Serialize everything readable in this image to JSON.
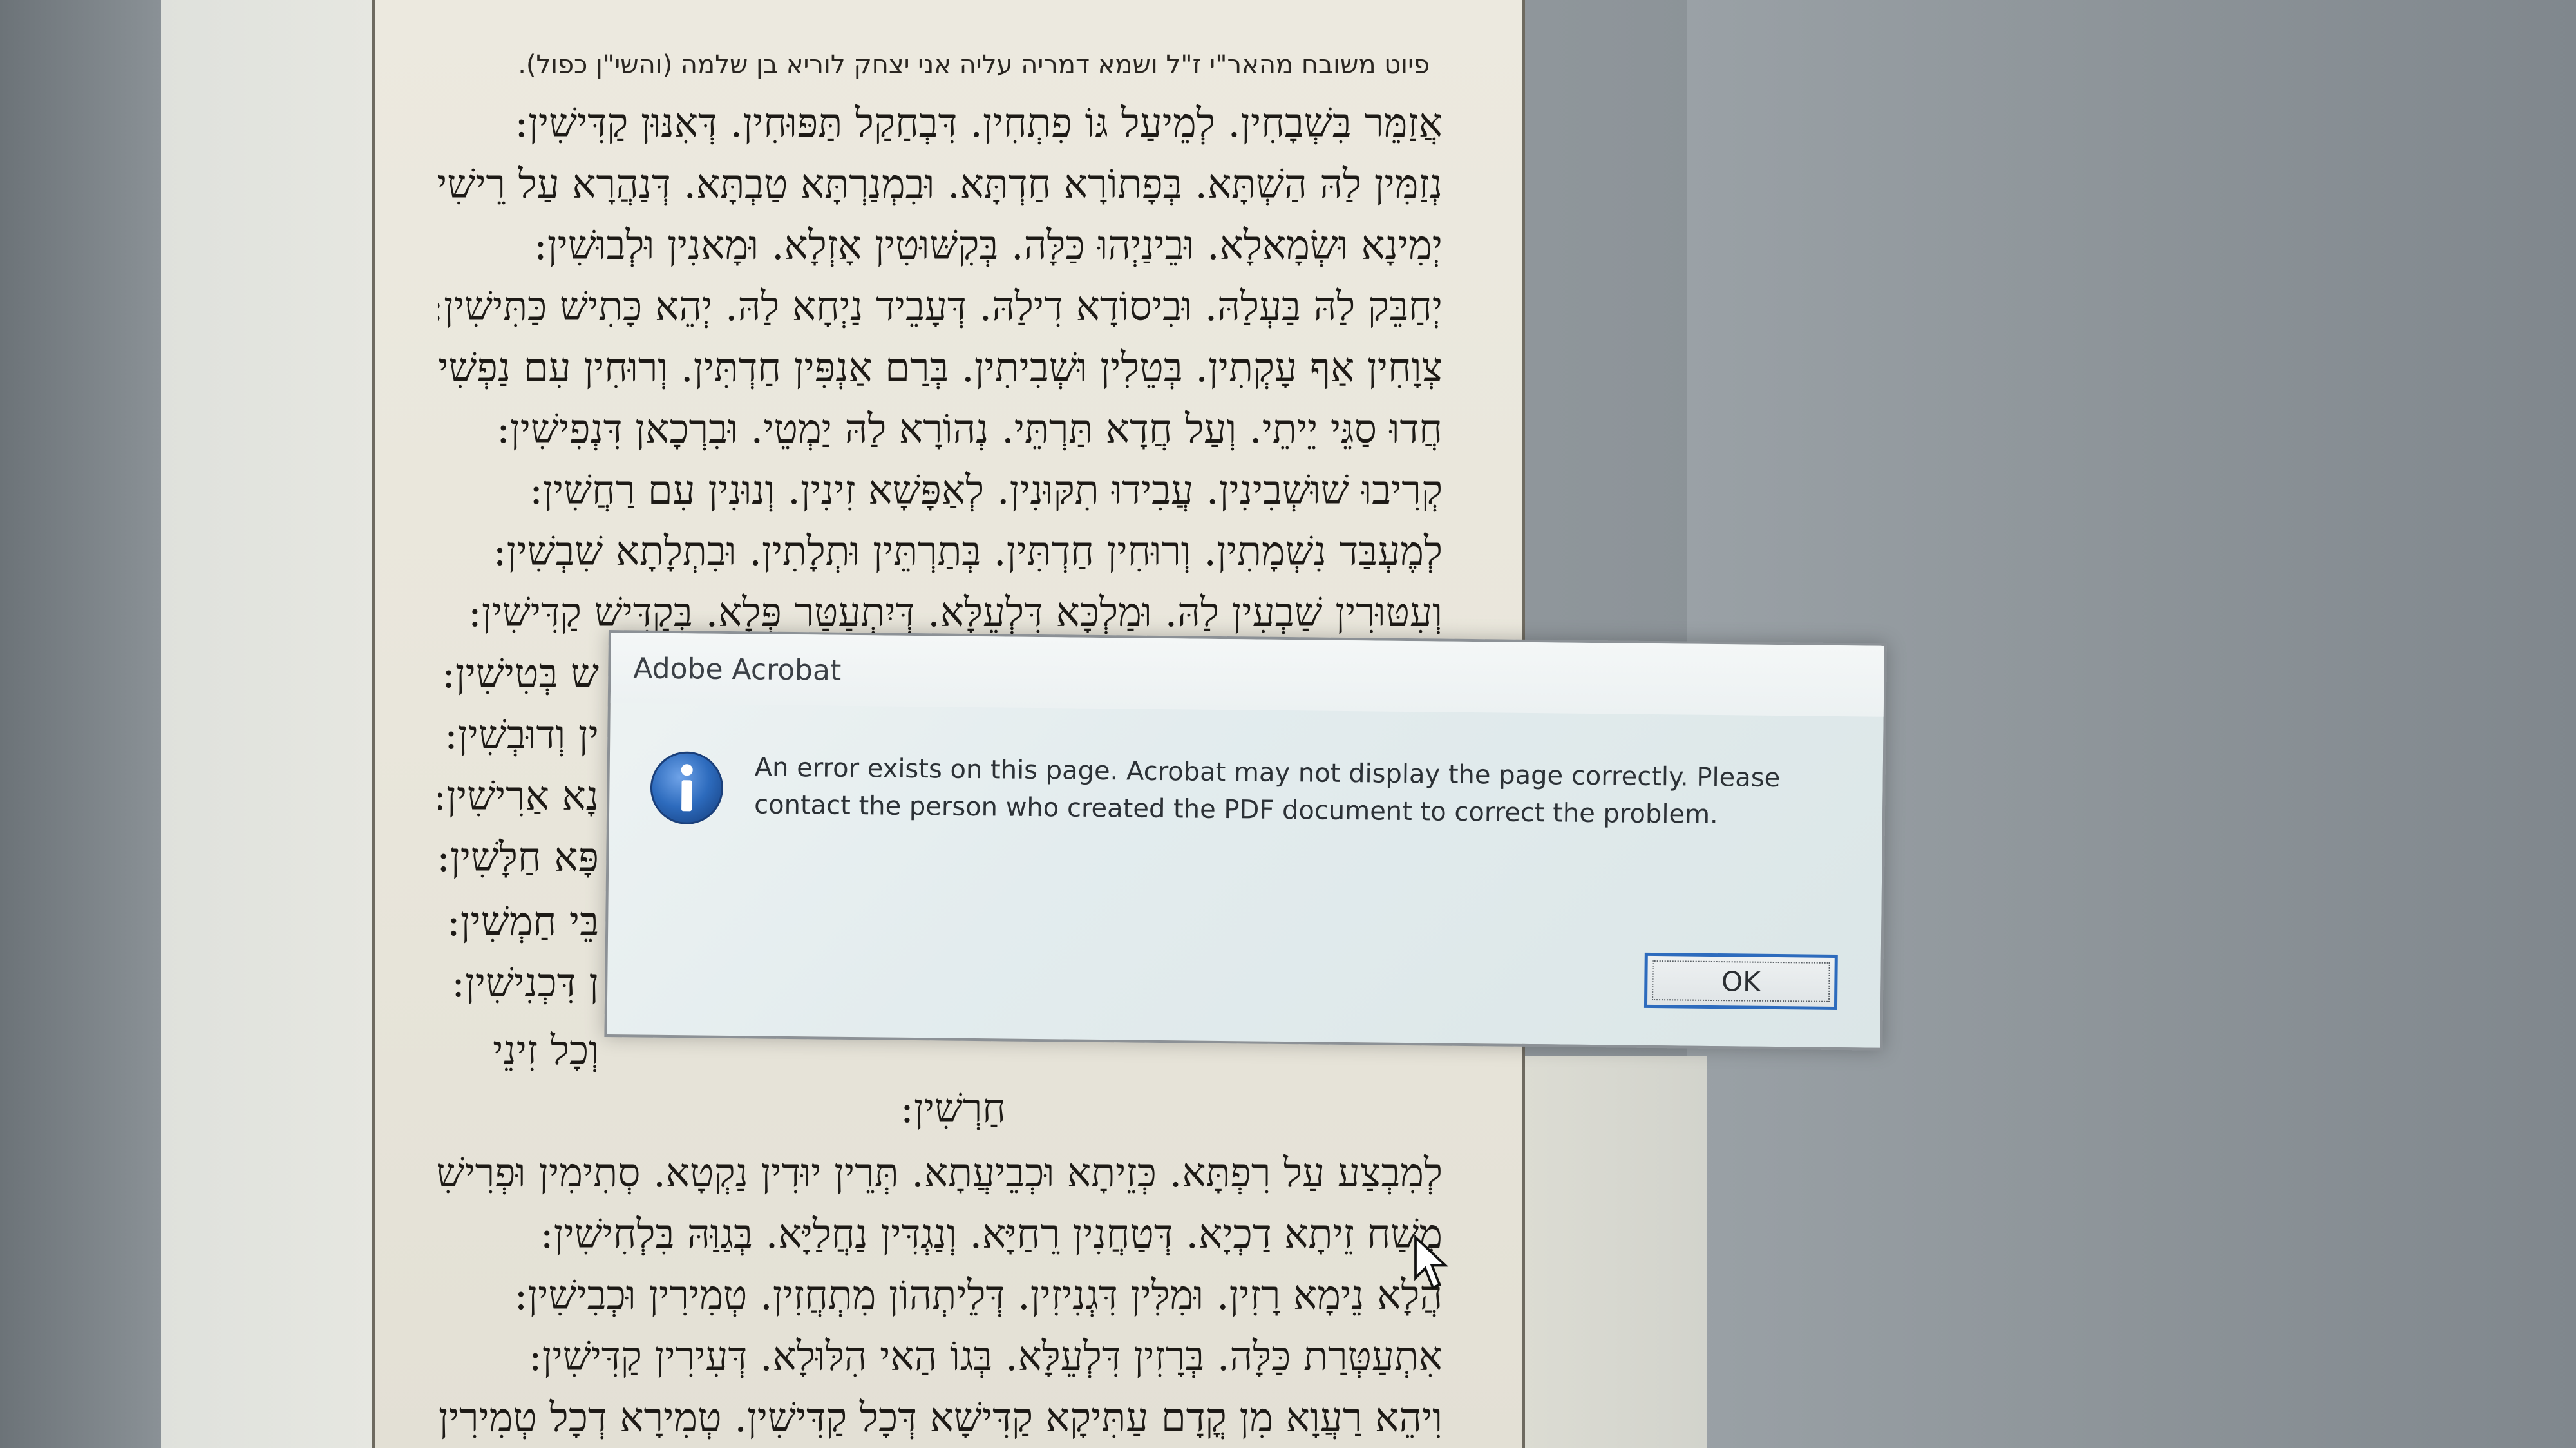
{
  "page": {
    "heading": "פיוט משובח מהאר\"י ז\"ל ושמא דמריה עליה אני יצחק לוריא בן שלמה (והשי\"ן כפול).",
    "lines": [
      "אֲזַמֵּר בִּשְׁבָחִין. לְמֵיעַל גּוֹ פִתְחִין. דִּבְחַקַל תַּפּוּחִין. דְּאִנּוּן קַדִּישִׁין:",
      "נְזַמִּין לַהּ הַשְׁתָּא. בְּפָתוֹרָא חַדְתָּא. וּבִמְנַרְתָּא טַבְתָּא. דְּנַהֲרָא עַל רֵישִׁין:",
      "יְמִינָא וּשְׂמָאלָא. וּבֵינַיְהוּ כַּלָּה. בְּקִשּׁוּטִין אָזְלָא. וּמָאנִין וּלְבוּשִׁין:",
      "יְחַבֵּק לַהּ בַּעְלַהּ. וּבִיסוֹדָא דִילַהּ. דְּעָבֵיד נַיְחָא לַהּ. יְהֵא כָּתִישׁ כַּתִּישִׁין:",
      "צְוָחִין אַף עָקְתִין. בְּטֵלִין וּשְׁבִיתִין. בְּרַם אַנְפִּין חַדְתִּין. וְרוּחִין עִם נַפְשִׁין:",
      "חֲדוּ סַגֵּי יֵיתֵי. וְעַל חֲדָא תַּרְתֵּי. נְהוֹרָא לַהּ יַמְטֵי. וּבִרְכָאן דִּנְפִישִׁין:",
      "קְרִיבוּ שׁוּשְׁבִינִין. עֲבִידוּ תִקּוּנִין. לְאַפָּשָׁא זִינִין. וְנוּנִין עִם רַחֲשִׁין:",
      "לְמֶעְבַּד נִשְׁמָתִין. וְרוּחִין חַדְתִּין. בְּתַרְתֵּין וּתְלָתִין. וּבִתְלָתָא שִׁבְשִׁין:",
      "וְעִטּוּרִין שַׁבְעִין לַהּ. וּמַלְכָּא דִּלְעֵלָּא. דְּיִתְעַטַּר פְּלָא. בְּקַדִּישׁ קַדִּישִׁין:",
      "ש בְּטִישִׁין:",
      "ין וְדוּבְשִׁין:",
      "נָא אַרִישִׁין:",
      "פָּא חַלָּשִׁין:",
      "בֵּי חַמְשִׁין:",
      "ן דִּכְנִישִׁין:",
      "וְכָל זִינֵי",
      "חַרְשִׁין:",
      "לְמִבְצַע עַל רִפְתָּא. כְּזֵיתָא וּכְבֵיעֲתָא. תְּרֵין יוּדִין נַקְטָא. סְתִימִין וּפְרִישִׁין:",
      "מְשַׁח זֵיתָא דַכְיָא. דְּטַחֲנִין רֵחַיָּא. וְנַגְדִּין נַחֲלַיָּא. בְּגַוַּהּ בִּלְחִישִׁין:",
      "הֲלָא נֵימָא רָזִין. וּמִלִּין דִּגְנִיזִין. דְּלֵיתְהוֹן מִתְחֲזִין. טְמִירִין וּכְבִישִׁין:",
      "אִתְעַטְּרַת כַּלָּה. בְּרָזִין דִּלְעֵלָּא. בְּגוֹ הַאי הִלּוּלָא. דְּעִירִין קַדִּישִׁין:",
      "וִיהֵא רַעֲוָא מִן קֳדָם עַתִּיקָא קַדִּישָׁא דְּכָל קַדִּישִׁין. טְמִירָא דְכָל טְמִירִין"
    ]
  },
  "dialog": {
    "title": "Adobe Acrobat",
    "message_line1": "An error exists on this page. Acrobat may not display the page correctly. Please",
    "message_line2": "contact the person who created the PDF document to correct the problem.",
    "ok_label": "OK",
    "icon": "info-icon",
    "accent_color": "#2d6bbd"
  }
}
